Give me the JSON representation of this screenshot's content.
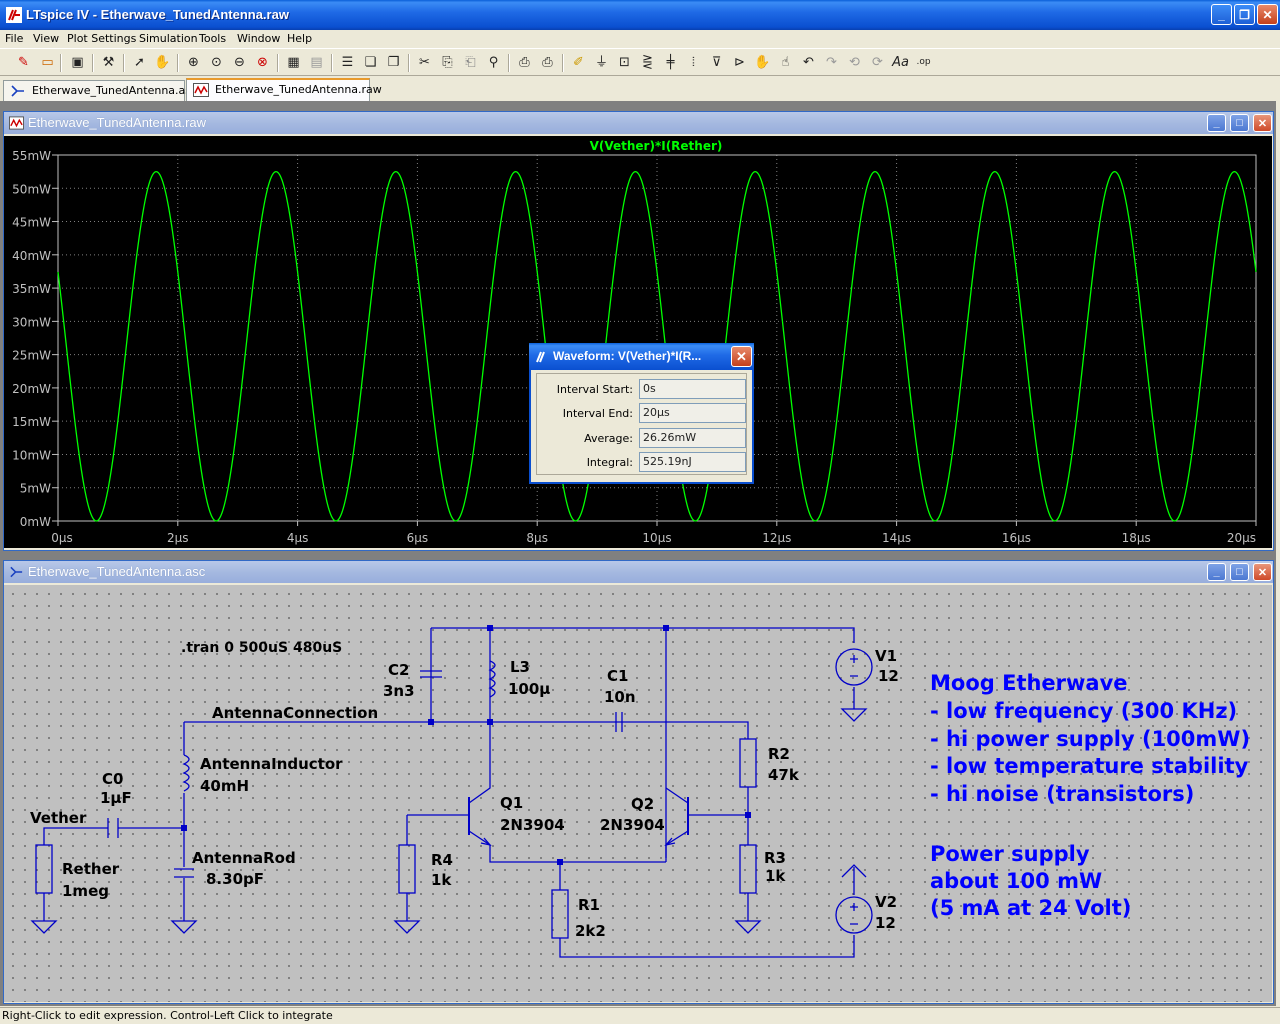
{
  "app": {
    "title": "LTspice IV - Etherwave_TunedAntenna.raw",
    "minimize": "_",
    "restore": "❐",
    "close": "✕"
  },
  "menu": [
    "File",
    "View",
    "Plot Settings",
    "Simulation",
    "Tools",
    "Window",
    "Help"
  ],
  "tabs": [
    {
      "label": "Etherwave_TunedAntenna.asc",
      "active": false
    },
    {
      "label": "Etherwave_TunedAntenna.raw",
      "active": true
    }
  ],
  "waveform_window": {
    "title": "Etherwave_TunedAntenna.raw",
    "trace_label": "V(Vether)*I(Rether)",
    "trace_color": "#00ff00"
  },
  "chart_data": {
    "type": "line",
    "title": "",
    "series": [
      {
        "name": "V(Vether)*I(Rether)",
        "period_us": 2.0,
        "min_mW": 0,
        "max_mW": 52.5,
        "first_peak_us": 1.64
      }
    ],
    "xlim": [
      0,
      20
    ],
    "ylim": [
      0,
      55
    ],
    "x_ticks": [
      "0µs",
      "2µs",
      "4µs",
      "6µs",
      "8µs",
      "10µs",
      "12µs",
      "14µs",
      "16µs",
      "18µs",
      "20µs"
    ],
    "y_ticks": [
      "0mW",
      "5mW",
      "10mW",
      "15mW",
      "20mW",
      "25mW",
      "30mW",
      "35mW",
      "40mW",
      "45mW",
      "50mW",
      "55mW"
    ],
    "grid": true
  },
  "dialog": {
    "title": "Waveform: V(Vether)*I(R...",
    "rows": [
      {
        "label": "Interval Start:",
        "value": "0s"
      },
      {
        "label": "Interval End:",
        "value": "20µs"
      },
      {
        "label": "Average:",
        "value": "26.26mW"
      },
      {
        "label": "Integral:",
        "value": "525.19nJ"
      }
    ]
  },
  "schematic_window": {
    "title": "Etherwave_TunedAntenna.asc",
    "wire_color": "#0000c8",
    "directive": ".tran 0 500uS 480uS",
    "net_antenna": "AntennaConnection",
    "components": {
      "C2": {
        "name": "C2",
        "value": "3n3"
      },
      "L3": {
        "name": "L3",
        "value": "100µ"
      },
      "C1": {
        "name": "C1",
        "value": "10n"
      },
      "V1": {
        "name": "V1",
        "value": "12"
      },
      "V2": {
        "name": "V2",
        "value": "12"
      },
      "C0": {
        "name": "C0",
        "value": "1µF"
      },
      "LA": {
        "name": "AntennaInductor",
        "value": "40mH"
      },
      "CR": {
        "name": "AntennaRod",
        "value": "8.30pF"
      },
      "RE": {
        "name": "Rether",
        "value": "1meg"
      },
      "R2": {
        "name": "R2",
        "value": "47k"
      },
      "R3": {
        "name": "R3",
        "value": "1k"
      },
      "R4": {
        "name": "R4",
        "value": "1k"
      },
      "R1": {
        "name": "R1",
        "value": "2k2"
      },
      "Q1": {
        "name": "Q1",
        "value": "2N3904"
      },
      "Q2": {
        "name": "Q2",
        "value": "2N3904"
      }
    },
    "net_vether": "Vether",
    "comment_color": "#0000ff",
    "comments": [
      "Moog Etherwave",
      "- low frequency (300 KHz)",
      "- hi power supply (100mW)",
      "- low temperature stability",
      "- hi noise (transistors)",
      "Power supply",
      "about 100 mW",
      "(5 mA at 24 Volt)"
    ]
  },
  "status": "Right-Click to edit expression. Control-Left Click to integrate"
}
